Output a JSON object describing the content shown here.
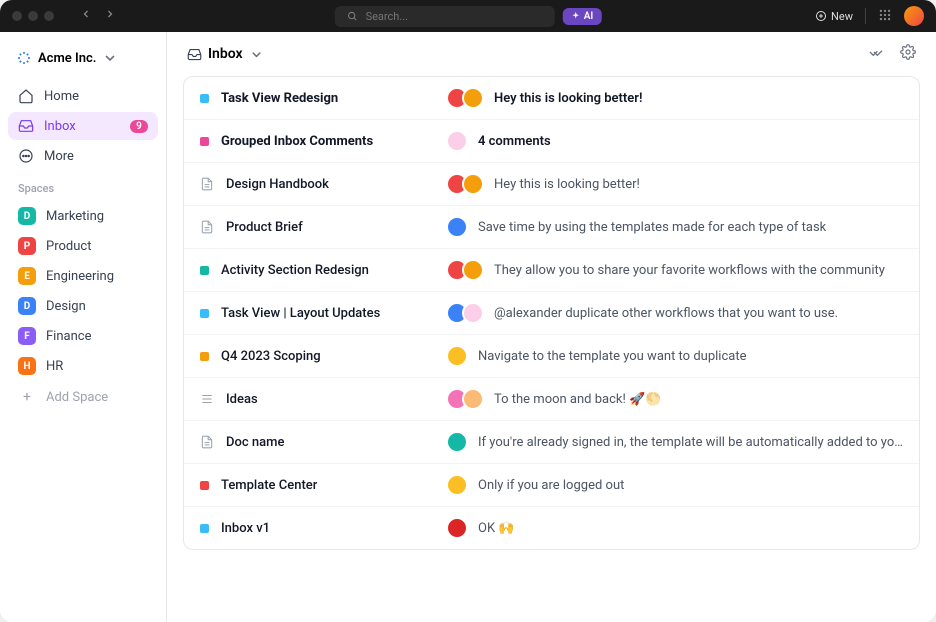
{
  "titlebar": {
    "search_placeholder": "Search...",
    "ai_label": "AI",
    "new_label": "New"
  },
  "workspace": {
    "name": "Acme Inc."
  },
  "nav": {
    "home": "Home",
    "inbox": "Inbox",
    "inbox_count": "9",
    "more": "More"
  },
  "spaces_label": "Spaces",
  "spaces": [
    {
      "letter": "D",
      "name": "Marketing",
      "color": "#14b8a6"
    },
    {
      "letter": "P",
      "name": "Product",
      "color": "#ef4444"
    },
    {
      "letter": "E",
      "name": "Engineering",
      "color": "#f59e0b"
    },
    {
      "letter": "D",
      "name": "Design",
      "color": "#3b82f6"
    },
    {
      "letter": "F",
      "name": "Finance",
      "color": "#8b5cf6"
    },
    {
      "letter": "H",
      "name": "HR",
      "color": "#f97316"
    }
  ],
  "add_space": "Add Space",
  "main_header": {
    "title": "Inbox"
  },
  "rows": [
    {
      "icon": "dot",
      "color": "#38bdf8",
      "title": "Task View Redesign",
      "bold": true,
      "avatars": [
        "#ef4444",
        "#f59e0b"
      ],
      "msg": "Hey this is looking better!"
    },
    {
      "icon": "dot",
      "color": "#ec4899",
      "title": "Grouped Inbox Comments",
      "bold": true,
      "avatars": [
        "#fbcfe8"
      ],
      "msg": "4 comments"
    },
    {
      "icon": "doc",
      "color": "",
      "title": "Design Handbook",
      "bold": false,
      "avatars": [
        "#ef4444",
        "#f59e0b"
      ],
      "msg": "Hey this is looking better!"
    },
    {
      "icon": "doc",
      "color": "",
      "title": "Product Brief",
      "bold": false,
      "avatars": [
        "#3b82f6"
      ],
      "msg": "Save time by using the templates made for each type of task"
    },
    {
      "icon": "dot",
      "color": "#14b8a6",
      "title": "Activity Section Redesign",
      "bold": false,
      "avatars": [
        "#ef4444",
        "#f59e0b"
      ],
      "msg": "They allow you to share your favorite workflows with the community"
    },
    {
      "icon": "dot",
      "color": "#38bdf8",
      "title": "Task View | Layout Updates",
      "bold": false,
      "avatars": [
        "#3b82f6",
        "#fbcfe8"
      ],
      "msg": "@alexander duplicate other workflows that you want to use."
    },
    {
      "icon": "dot",
      "color": "#f59e0b",
      "title": "Q4 2023 Scoping",
      "bold": false,
      "avatars": [
        "#fbbf24"
      ],
      "msg": "Navigate to the template you want to duplicate"
    },
    {
      "icon": "list",
      "color": "",
      "title": "Ideas",
      "bold": false,
      "avatars": [
        "#f472b6",
        "#fdba74"
      ],
      "msg": "To the moon and back! 🚀🌕"
    },
    {
      "icon": "doc",
      "color": "",
      "title": "Doc name",
      "bold": false,
      "avatars": [
        "#14b8a6"
      ],
      "msg": "If you're already signed in, the template will be automatically added to your..."
    },
    {
      "icon": "dot",
      "color": "#ef4444",
      "title": "Template Center",
      "bold": false,
      "avatars": [
        "#fbbf24"
      ],
      "msg": "Only if you are logged out"
    },
    {
      "icon": "dot",
      "color": "#38bdf8",
      "title": "Inbox v1",
      "bold": false,
      "avatars": [
        "#dc2626"
      ],
      "msg": "OK 🙌"
    }
  ]
}
